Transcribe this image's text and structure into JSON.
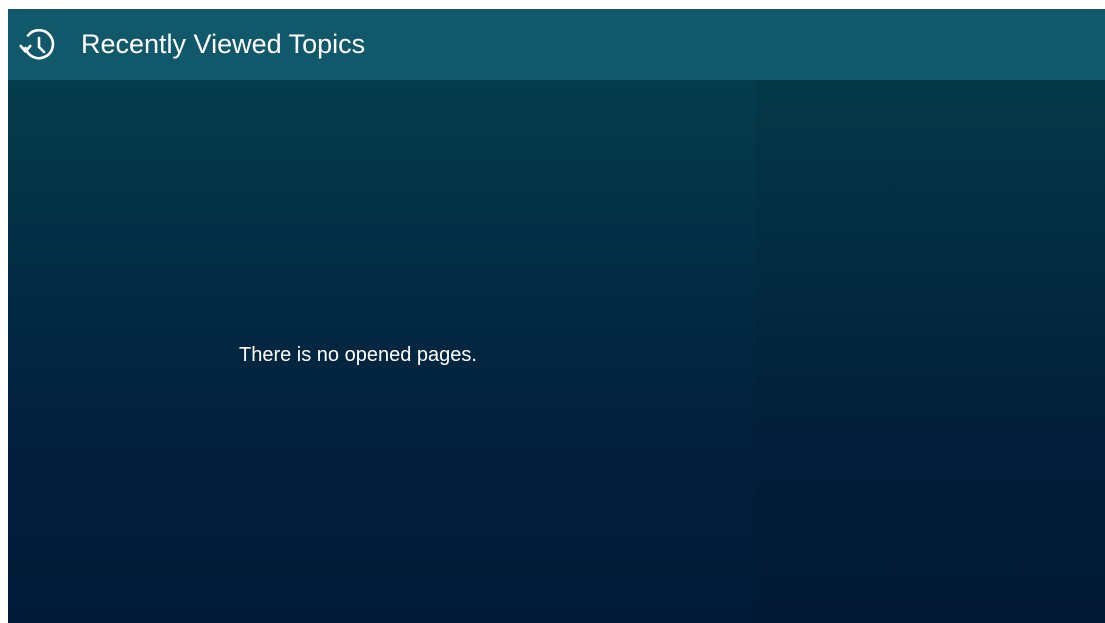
{
  "header": {
    "title": "Recently Viewed Topics",
    "icon": "history-icon"
  },
  "main": {
    "empty_message": "There is no opened pages."
  },
  "colors": {
    "header_background": "#11586a",
    "content_background_top": "#04424f",
    "content_background_bottom": "#011a37",
    "text": "#ffffff"
  }
}
